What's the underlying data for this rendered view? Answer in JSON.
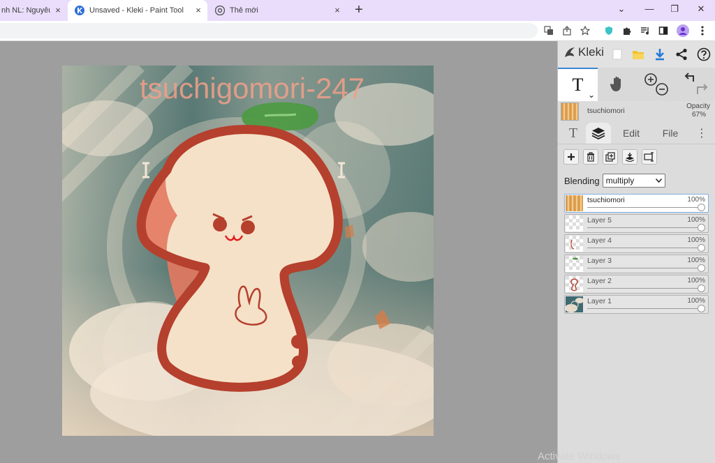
{
  "browser": {
    "tabs": [
      {
        "title": "nh NL: Nguyêu tắ",
        "active": false
      },
      {
        "title": "Unsaved - Kleki - Paint Tool",
        "active": true
      },
      {
        "title": "Thẻ mới",
        "active": false
      }
    ],
    "close_glyph": "×",
    "new_tab_glyph": "+",
    "window_controls": {
      "minimize": "⌄",
      "min2": "—",
      "restore": "❐",
      "close": "✕"
    },
    "toolbar_icons": [
      "translate-icon",
      "share-icon",
      "star-icon",
      "extension-shield-icon",
      "puzzle-icon",
      "media-icon",
      "sidepanel-icon",
      "profile-icon",
      "menu-icon"
    ],
    "accent_color": "#e9ddfb"
  },
  "artwork": {
    "overlay_text": "tsuchigomori-247"
  },
  "kleki": {
    "brand": "Kleki",
    "top_icons": [
      "new-file-icon",
      "open-folder-icon",
      "download-icon",
      "share-icon",
      "help-icon"
    ],
    "tools": {
      "text_tool": "T",
      "dropdown": "⌄",
      "hand_tool": "hand-icon",
      "zoom": [
        "zoom-in-icon",
        "zoom-out-icon"
      ],
      "history": [
        "undo-icon",
        "redo-icon"
      ]
    },
    "brush": {
      "name": "tsuchiomori",
      "opacity_label": "Opacity",
      "opacity_value": "67%"
    },
    "tabs": [
      {
        "label": "T",
        "active": false
      },
      {
        "label": "layers-icon",
        "active": true
      },
      {
        "label": "Edit",
        "active": false
      },
      {
        "label": "File",
        "active": false
      }
    ],
    "more_glyph": "⋮",
    "layer_actions": [
      "add-layer",
      "delete-layer",
      "duplicate-layer",
      "merge-down",
      "rename-layer"
    ],
    "blending_label": "Blending",
    "blending_value": "multiply",
    "layers": [
      {
        "name": "tsuchiomori",
        "opacity": "100%",
        "active": true
      },
      {
        "name": "Layer 5",
        "opacity": "100%",
        "active": false
      },
      {
        "name": "Layer 4",
        "opacity": "100%",
        "active": false
      },
      {
        "name": "Layer 3",
        "opacity": "100%",
        "active": false
      },
      {
        "name": "Layer 2",
        "opacity": "100%",
        "active": false
      },
      {
        "name": "Layer 1",
        "opacity": "100%",
        "active": false
      }
    ]
  },
  "os": {
    "watermark": "Activate Windows"
  }
}
